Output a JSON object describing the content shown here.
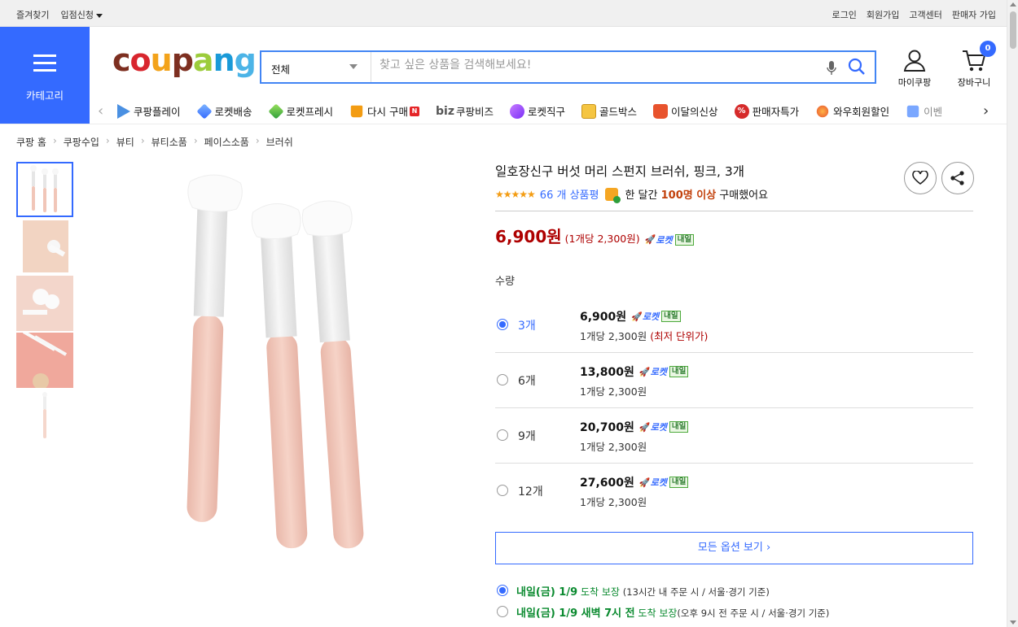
{
  "topbar": {
    "left": [
      "즐겨찾기",
      "입점신청"
    ],
    "right": [
      "로그인",
      "회원가입",
      "고객센터",
      "판매자 가입"
    ]
  },
  "category": {
    "label": "카테고리"
  },
  "logo": {
    "text": "coupang"
  },
  "search": {
    "scope": "전체",
    "placeholder": "찾고 싶은 상품을 검색해보세요!"
  },
  "user": {
    "my_label": "마이쿠팡",
    "cart_label": "장바구니",
    "cart_count": "0"
  },
  "nav": {
    "items": [
      "쿠팡플레이",
      "로켓배송",
      "로켓프레시",
      "다시 구매",
      "쿠팡비즈",
      "로켓직구",
      "골드박스",
      "이달의신상",
      "판매자특가",
      "와우회원할인",
      "이벤"
    ],
    "biz_prefix": "biz",
    "new_badge": "N"
  },
  "breadcrumb": [
    "쿠팡 홈",
    "쿠팡수입",
    "뷰티",
    "뷰티소품",
    "페이스소품",
    "브러쉬"
  ],
  "product": {
    "title": "일호장신구 버섯 머리 스펀지 브러쉬, 핑크, 3개",
    "stars": "★★★★★",
    "review_text": "66 개 상품평",
    "bought_prefix": "한 달간",
    "bought_count": "100명 이상",
    "bought_suffix": "구매했어요",
    "price": "6,900원",
    "unit_price": "(1개당 2,300원)",
    "rocket_label": "로켓",
    "tomorrow_badge": "내일",
    "quantity_label": "수량"
  },
  "options": [
    {
      "count": "3개",
      "price": "6,900원",
      "unit": "1개당 2,300원",
      "note": "(최저 단위가)",
      "selected": true
    },
    {
      "count": "6개",
      "price": "13,800원",
      "unit": "1개당 2,300원",
      "note": "",
      "selected": false
    },
    {
      "count": "9개",
      "price": "20,700원",
      "unit": "1개당 2,300원",
      "note": "",
      "selected": false
    },
    {
      "count": "12개",
      "price": "27,600원",
      "unit": "1개당 2,300원",
      "note": "",
      "selected": false
    }
  ],
  "all_options": "모든 옵션 보기 ›",
  "delivery": [
    {
      "main": "내일(금) 1/9",
      "suffix": "도착 보장",
      "note": "(13시간 내 주문 시 / 서울·경기 기준)",
      "selected": true
    },
    {
      "main": "내일(금) 1/9 새벽 7시 전",
      "suffix": "도착 보장",
      "note": "(오후 9시 전 주문 시 / 서울·경기 기준)",
      "selected": false
    }
  ],
  "colors": {
    "accent": "#346aff",
    "price": "#ae0000",
    "delivery": "#0a8a2f"
  }
}
